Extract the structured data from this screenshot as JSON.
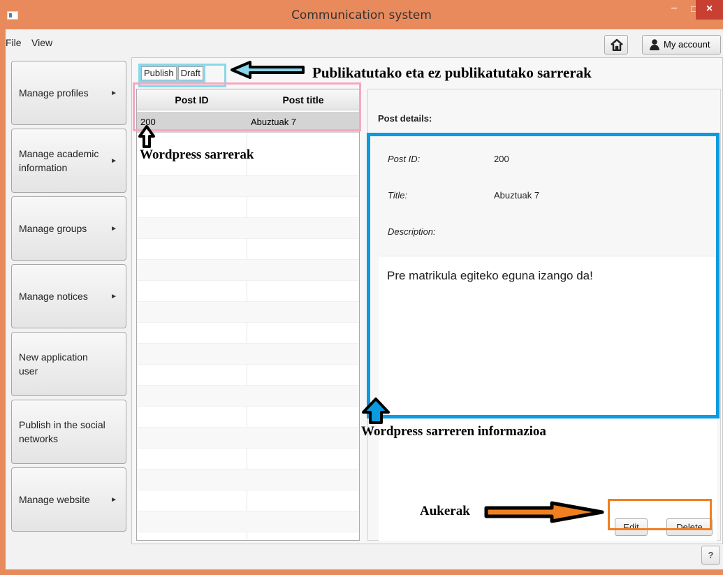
{
  "window": {
    "title": "Communication system",
    "minimize_glyph": "−",
    "maximize_glyph": "□",
    "close_glyph": "×",
    "icon": "window-icon"
  },
  "menu": {
    "file": "File",
    "view": "View",
    "home_icon": "home-icon",
    "account": "My account"
  },
  "sidebar": {
    "items": [
      {
        "label": "Manage profiles",
        "arrow": "►"
      },
      {
        "label": "Manage academic information",
        "arrow": "►"
      },
      {
        "label": "Manage groups",
        "arrow": "►"
      },
      {
        "label": "Manage notices",
        "arrow": "►"
      },
      {
        "label": "New application user",
        "arrow": ""
      },
      {
        "label": "Publish in the social networks",
        "arrow": ""
      },
      {
        "label": "Manage website",
        "arrow": "►"
      }
    ]
  },
  "tabs": {
    "publish": "Publish",
    "draft": "Draft"
  },
  "table": {
    "headers": [
      "Post ID",
      "Post title"
    ],
    "rows": [
      [
        "200",
        "Abuztuak 7"
      ]
    ]
  },
  "details": {
    "title": "Post details:",
    "post_id_label": "Post ID:",
    "post_id_value": "200",
    "title_label": "Title:",
    "title_value": "Abuztuak 7",
    "description_label": "Description:",
    "description_value": "Pre matrikula egiteko eguna izango da!"
  },
  "actions": {
    "edit": "Edit",
    "delete": "Delete"
  },
  "footer": {
    "help": "?"
  },
  "annotations": {
    "tabs_note": "Publikatutako eta ez publikatutako sarrerak",
    "table_note": "Wordpress sarrerak",
    "details_note": "Wordpress sarreren informazioa",
    "actions_note": "Aukerak"
  },
  "colors": {
    "title_bar": "#e98a5d",
    "tabs_highlight": "#8ad7ea",
    "table_outline": "#f6a7c1",
    "details_outline": "#0b9be0",
    "actions_outline": "#f07f22",
    "selected_row": "#d4d4d4"
  }
}
